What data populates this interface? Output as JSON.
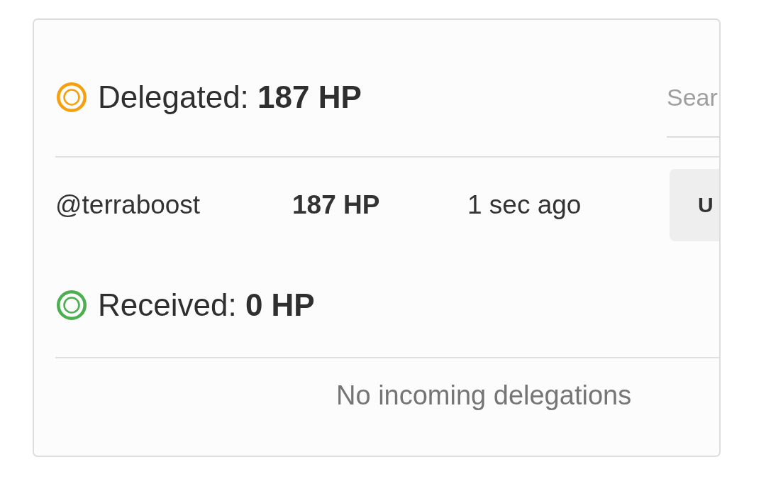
{
  "sections": [
    {
      "title": "Delegated: **187 HP**",
      "color": "#f5a00f",
      "search": {
        "placeholder": "Sear"
      },
      "rows": [
        {
          "account": "@terraboost",
          "amount": "187 HP",
          "time": "1 sec ago",
          "action": "U"
        }
      ]
    },
    {
      "title": "Received: **0 HP**",
      "color": "#4caf50",
      "empty_message": "No incoming delegations"
    }
  ]
}
